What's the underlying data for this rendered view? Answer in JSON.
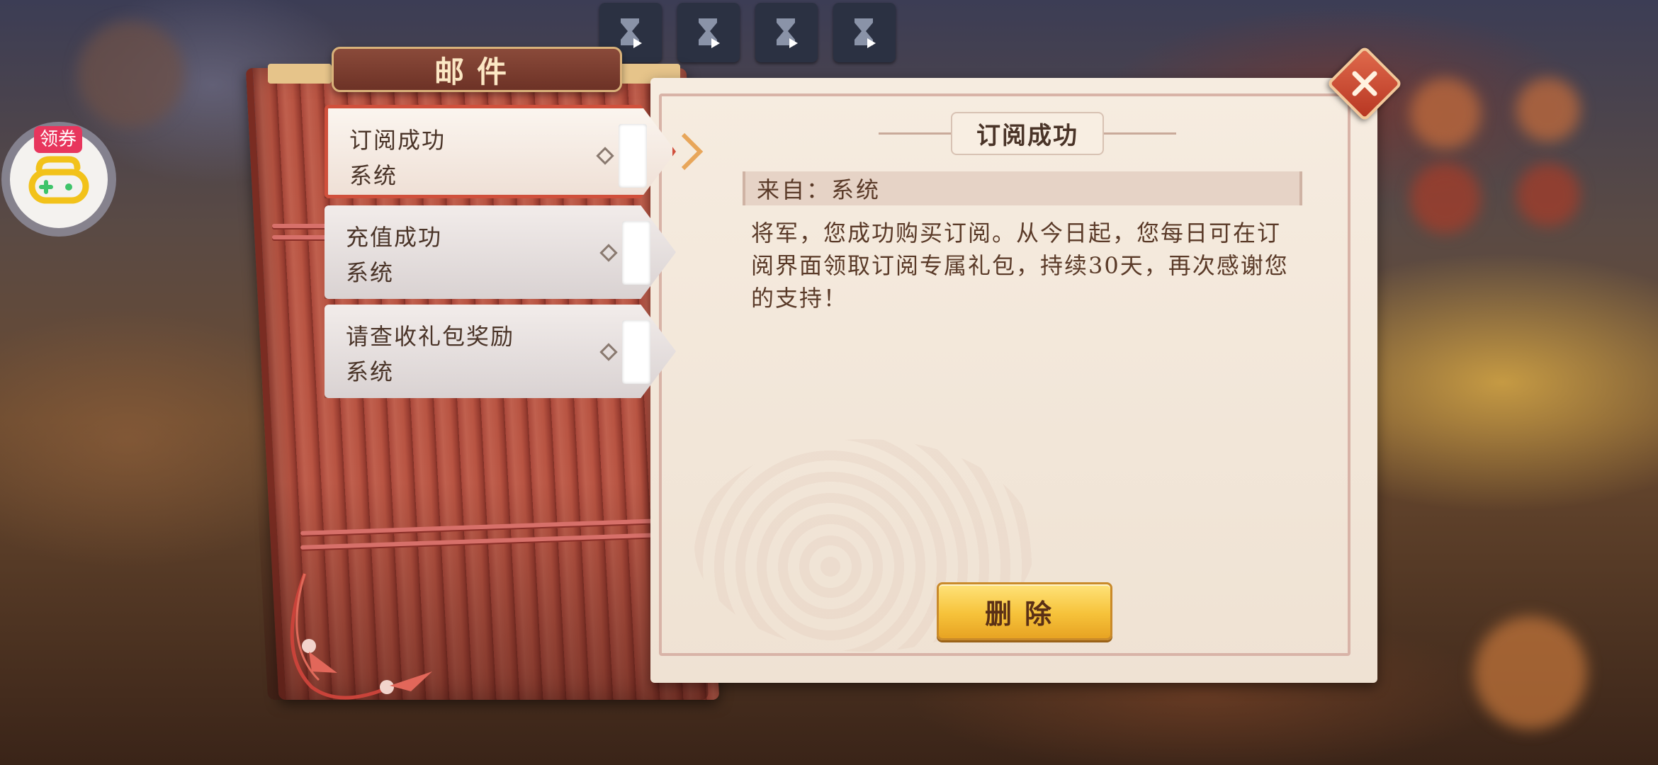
{
  "window": {
    "title": "邮件",
    "close_icon": "close-x-icon"
  },
  "top_slots": [
    {
      "icon": "hourglass-play-icon"
    },
    {
      "icon": "hourglass-play-icon"
    },
    {
      "icon": "hourglass-play-icon"
    },
    {
      "icon": "hourglass-play-icon"
    }
  ],
  "coupon_widget": {
    "tag": "领券",
    "icon": "gamepad-icon"
  },
  "mail_list": [
    {
      "title": "订阅成功",
      "sender": "系统",
      "selected": true
    },
    {
      "title": "充值成功",
      "sender": "系统",
      "selected": false
    },
    {
      "title": "请查收礼包奖励",
      "sender": "系统",
      "selected": false
    }
  ],
  "detail": {
    "title": "订阅成功",
    "from_label": "来自：系统",
    "body": "将军，您成功购买订阅。从今日起，您每日可在订阅界面领取订阅专属礼包，持续30天，再次感谢您的支持！",
    "delete_button": "删除"
  },
  "colors": {
    "accent_red": "#d0503c",
    "button_gold": "#f6c23a",
    "paper": "#f6ece0",
    "bamboo": "#b85442",
    "coupon_tag": "#e8365d"
  }
}
